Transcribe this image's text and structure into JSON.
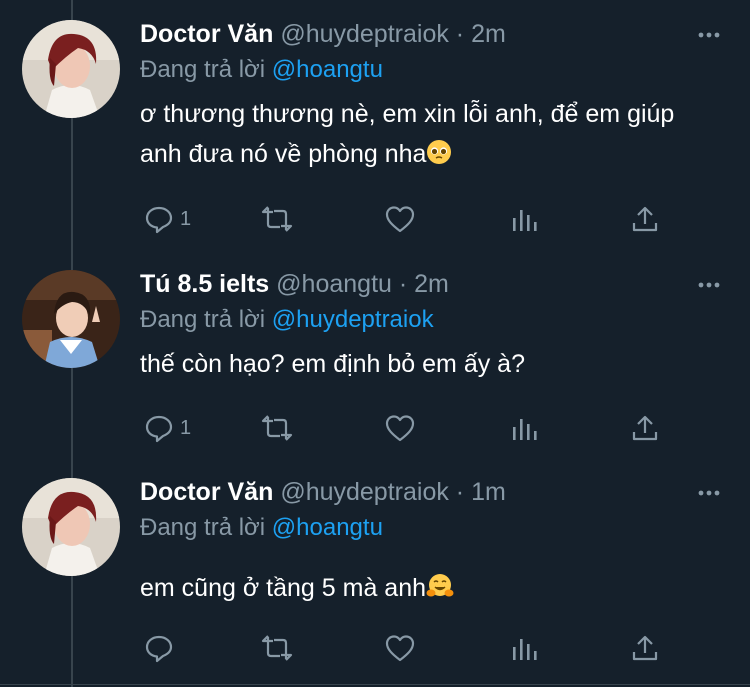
{
  "tweets": [
    {
      "name": "Doctor Văn",
      "handle": "@huydeptraiok",
      "dot": "·",
      "time": "2m",
      "reply_prefix": "Đang trả lời",
      "reply_to": "@hoangtu",
      "text": "ơ thương thương nè, em xin lỗi anh, để em giúp anh đưa nó về phòng nha",
      "emoji": "pleading-face-emoji",
      "reply_count": "1"
    },
    {
      "name": "Tú 8.5 ielts",
      "handle": "@hoangtu",
      "dot": "·",
      "time": "2m",
      "reply_prefix": "Đang trả lời",
      "reply_to": "@huydeptraiok",
      "text": "thế còn hạo? em định bỏ em ấy à?",
      "emoji": "",
      "reply_count": "1"
    },
    {
      "name": "Doctor Văn",
      "handle": "@huydeptraiok",
      "dot": "·",
      "time": "1m",
      "reply_prefix": "Đang trả lời",
      "reply_to": "@hoangtu",
      "text": "em cũng ở tầng 5 mà anh",
      "emoji": "hugging-face-emoji",
      "reply_count": ""
    }
  ],
  "colors": {
    "background": "#15202b",
    "text": "#ffffff",
    "secondary": "#8899a6",
    "link": "#1da1f2",
    "divider": "#38444d"
  },
  "icons": [
    "more-icon",
    "reply-icon",
    "retweet-icon",
    "like-icon",
    "analytics-icon",
    "share-icon"
  ]
}
